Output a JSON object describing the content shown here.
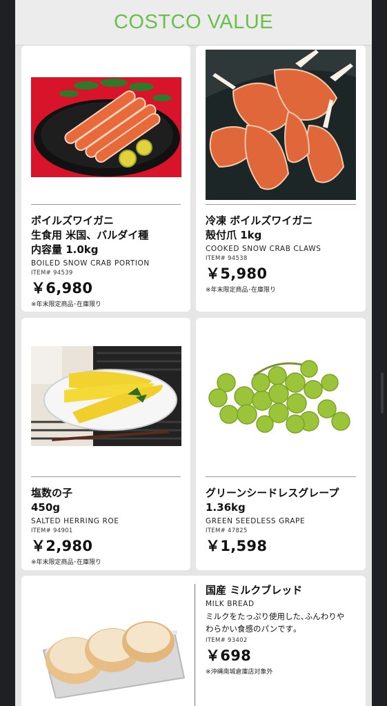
{
  "header": {
    "brand": "COSTCO VALUE",
    "brand_color": "#6abe4a"
  },
  "products": [
    {
      "title": "ボイルズワイガニ\n生食用 米国、バルダイ種\n内容量 1.0kg",
      "english": "BOILED SNOW CRAB PORTION",
      "item": "ITEM# 94539",
      "price": "￥6,980",
      "note": "※年末限定商品･在庫限り",
      "image": "boiled-crab-platter-image"
    },
    {
      "title": "冷凍 ボイルズワイガニ\n殻付爪 1kg",
      "english": "COOKED SNOW CRAB CLAWS",
      "item": "ITEM# 94538",
      "price": "￥5,980",
      "note": "※年末限定商品･在庫限り",
      "image": "crab-claws-image"
    },
    {
      "title": "塩数の子\n450g",
      "english": "SALTED HERRING ROE",
      "item": "ITEM# 94901",
      "price": "￥2,980",
      "note": "※年末限定商品･在庫限り",
      "image": "herring-roe-image"
    },
    {
      "title": "グリーンシードレスグレープ\n1.36kg",
      "english": "GREEN SEEDLESS GRAPE",
      "item": "ITEM# 47825",
      "price": "￥1,598",
      "image": "green-grapes-image"
    },
    {
      "title": "国産 ミルクブレッド",
      "english": "MILK BREAD",
      "description": "ミルクをたっぷり使用した､ふんわりや\nわらかい食感のパンです｡",
      "item": "ITEM# 93402",
      "price": "￥698",
      "note": "※沖縄南城倉庫店対象外",
      "image": "milk-bread-image"
    }
  ]
}
